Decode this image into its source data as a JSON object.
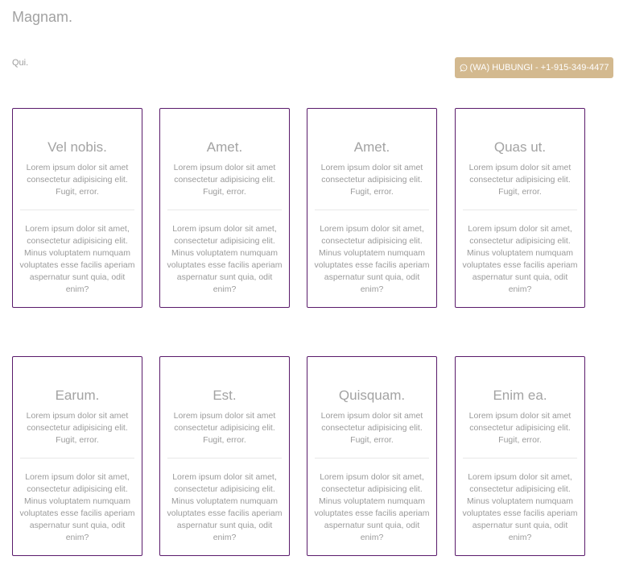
{
  "header": {
    "title": "Magnam.",
    "subtitle": "Qui."
  },
  "contact_button": {
    "label": "(WA) HUBUNGI - +1-915-349-4477",
    "icon": "whatsapp-icon",
    "color": "#d3b98f"
  },
  "accent_border_color": "#5a1a6b",
  "cards": [
    {
      "title": "Vel nobis.",
      "short": "Lorem ipsum dolor sit amet consectetur adipisicing elit. Fugit, error.",
      "long": "Lorem ipsum dolor sit amet, consectetur adipisicing elit. Minus voluptatem numquam voluptates esse facilis aperiam aspernatur sunt quia, odit enim?"
    },
    {
      "title": "Amet.",
      "short": "Lorem ipsum dolor sit amet consectetur adipisicing elit. Fugit, error.",
      "long": "Lorem ipsum dolor sit amet, consectetur adipisicing elit. Minus voluptatem numquam voluptates esse facilis aperiam aspernatur sunt quia, odit enim?"
    },
    {
      "title": "Amet.",
      "short": "Lorem ipsum dolor sit amet consectetur adipisicing elit. Fugit, error.",
      "long": "Lorem ipsum dolor sit amet, consectetur adipisicing elit. Minus voluptatem numquam voluptates esse facilis aperiam aspernatur sunt quia, odit enim?"
    },
    {
      "title": "Quas ut.",
      "short": "Lorem ipsum dolor sit amet consectetur adipisicing elit. Fugit, error.",
      "long": "Lorem ipsum dolor sit amet, consectetur adipisicing elit. Minus voluptatem numquam voluptates esse facilis aperiam aspernatur sunt quia, odit enim?"
    },
    {
      "title": "Earum.",
      "short": "Lorem ipsum dolor sit amet consectetur adipisicing elit. Fugit, error.",
      "long": "Lorem ipsum dolor sit amet, consectetur adipisicing elit. Minus voluptatem numquam voluptates esse facilis aperiam aspernatur sunt quia, odit enim?"
    },
    {
      "title": "Est.",
      "short": "Lorem ipsum dolor sit amet consectetur adipisicing elit. Fugit, error.",
      "long": "Lorem ipsum dolor sit amet, consectetur adipisicing elit. Minus voluptatem numquam voluptates esse facilis aperiam aspernatur sunt quia, odit enim?"
    },
    {
      "title": "Quisquam.",
      "short": "Lorem ipsum dolor sit amet consectetur adipisicing elit. Fugit, error.",
      "long": "Lorem ipsum dolor sit amet, consectetur adipisicing elit. Minus voluptatem numquam voluptates esse facilis aperiam aspernatur sunt quia, odit enim?"
    },
    {
      "title": "Enim ea.",
      "short": "Lorem ipsum dolor sit amet consectetur adipisicing elit. Fugit, error.",
      "long": "Lorem ipsum dolor sit amet, consectetur adipisicing elit. Minus voluptatem numquam voluptates esse facilis aperiam aspernatur sunt quia, odit enim?"
    }
  ]
}
